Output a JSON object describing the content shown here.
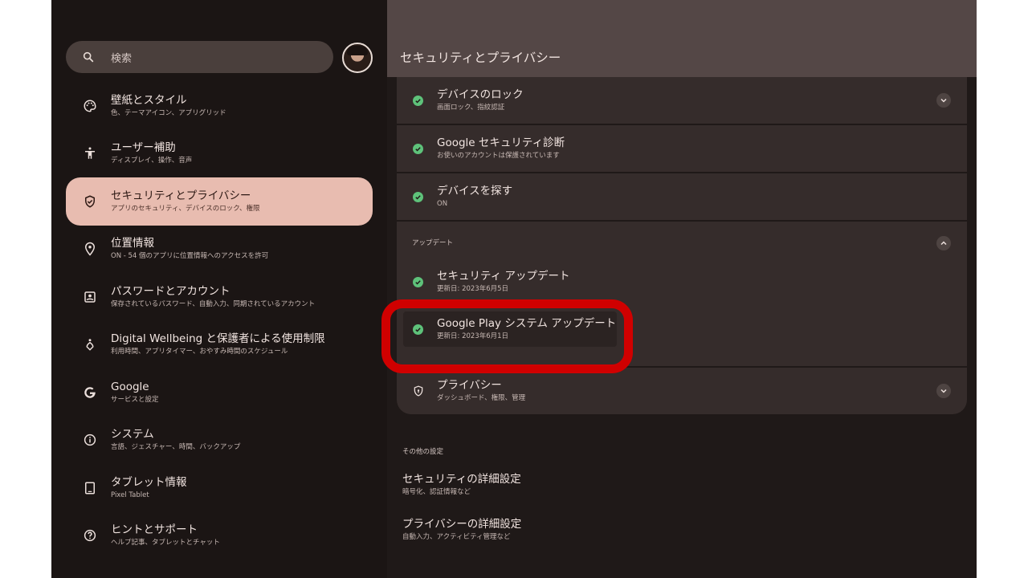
{
  "search": {
    "placeholder": "検索"
  },
  "sidebar": {
    "items": [
      {
        "label": "壁紙とスタイル",
        "sub": "色、テーマアイコン、アプリグリッド",
        "icon": "palette-icon"
      },
      {
        "label": "ユーザー補助",
        "sub": "ディスプレイ、操作、音声",
        "icon": "accessibility-icon"
      },
      {
        "label": "セキュリティとプライバシー",
        "sub": "アプリのセキュリティ、デバイスのロック、権限",
        "icon": "shield-check-icon",
        "active": true
      },
      {
        "label": "位置情報",
        "sub": "ON - 54 個のアプリに位置情報へのアクセスを許可",
        "icon": "location-pin-icon"
      },
      {
        "label": "パスワードとアカウント",
        "sub": "保存されているパスワード、自動入力、同期されているアカウント",
        "icon": "account-box-icon"
      },
      {
        "label": "Digital Wellbeing と保護者による使用制限",
        "sub": "利用時間、アプリタイマー、おやすみ時間のスケジュール",
        "icon": "wellbeing-icon"
      },
      {
        "label": "Google",
        "sub": "サービスと設定",
        "icon": "google-icon"
      },
      {
        "label": "システム",
        "sub": "言語、ジェスチャー、時間、バックアップ",
        "icon": "info-icon"
      },
      {
        "label": "タブレット情報",
        "sub": "Pixel Tablet",
        "icon": "tablet-icon"
      },
      {
        "label": "ヒントとサポート",
        "sub": "ヘルプ記事、タブレットとチャット",
        "icon": "help-icon"
      }
    ]
  },
  "header": {
    "title": "セキュリティとプライバシー"
  },
  "main": {
    "rows": [
      {
        "label": "デバイスのロック",
        "sub": "画面ロック、指紋認証"
      },
      {
        "label": "Google セキュリティ診断",
        "sub": "お使いのアカウントは保護されています"
      },
      {
        "label": "デバイスを探す",
        "sub": "ON"
      }
    ],
    "updates": {
      "section": "アップデート",
      "items": [
        {
          "label": "セキュリティ アップデート",
          "sub": "更新日: 2023年6月5日"
        },
        {
          "label": "Google Play システム アップデート",
          "sub": "更新日: 2023年6月1日"
        }
      ]
    },
    "privacy": {
      "label": "プライバシー",
      "sub": "ダッシュボード、権限、管理"
    },
    "other": {
      "section": "その他の設定",
      "items": [
        {
          "label": "セキュリティの詳細設定",
          "sub": "暗号化、認証情報など"
        },
        {
          "label": "プライバシーの詳細設定",
          "sub": "自動入力、アクティビティ管理など"
        }
      ]
    }
  },
  "colors": {
    "accent": "#e8bcb0",
    "check": "#5ec27a",
    "highlight": "#d00000"
  }
}
